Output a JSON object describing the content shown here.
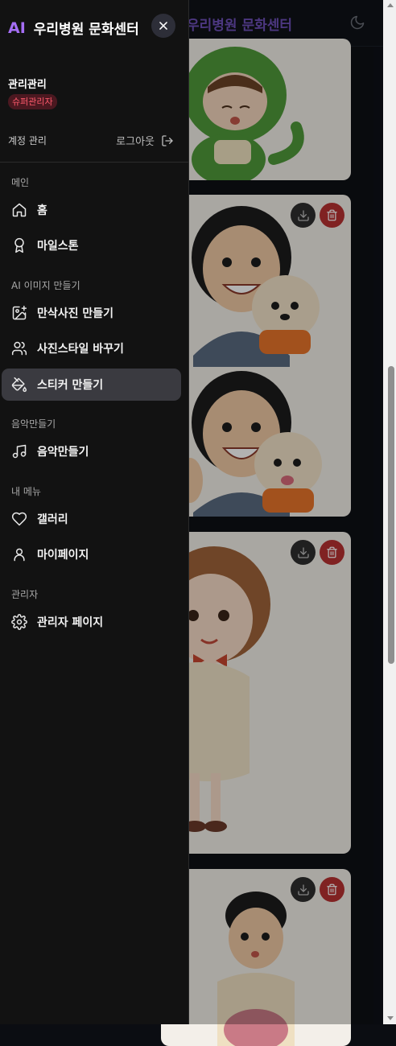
{
  "background": {
    "header_title": "우리병원 문화센터",
    "theme_toggle_icon": "moon-icon",
    "cards": [
      {
        "download_icon": "download-icon",
        "delete_icon": "trash-icon"
      },
      {
        "download_icon": "download-icon",
        "delete_icon": "trash-icon"
      },
      {
        "download_icon": "download-icon",
        "delete_icon": "trash-icon"
      },
      {
        "download_icon": "download-icon",
        "delete_icon": "trash-icon"
      }
    ]
  },
  "sidebar": {
    "brand_ai": "AI",
    "brand_name": "우리병원 문화센터",
    "close_icon": "close-icon",
    "user_name": "관리관리",
    "role_badge": "슈퍼관리자",
    "account_label": "계정 관리",
    "logout_label": "로그아웃",
    "sections": [
      {
        "label": "메인",
        "items": [
          {
            "label": "홈",
            "icon": "home-icon"
          },
          {
            "label": "마일스톤",
            "icon": "award-icon"
          }
        ]
      },
      {
        "label": "AI 이미지 만들기",
        "items": [
          {
            "label": "만삭사진 만들기",
            "icon": "image-plus-icon"
          },
          {
            "label": "사진스타일 바꾸기",
            "icon": "users-icon"
          },
          {
            "label": "스티커 만들기",
            "icon": "paint-bucket-icon",
            "active": true
          }
        ]
      },
      {
        "label": "음악만들기",
        "items": [
          {
            "label": "음악만들기",
            "icon": "music-icon"
          }
        ]
      },
      {
        "label": "내 메뉴",
        "items": [
          {
            "label": "갤러리",
            "icon": "heart-icon"
          },
          {
            "label": "마이페이지",
            "icon": "user-icon"
          }
        ]
      },
      {
        "label": "관리자",
        "items": [
          {
            "label": "관리자 페이지",
            "icon": "settings-icon"
          }
        ]
      }
    ]
  },
  "colors": {
    "accent": "#a56ef5",
    "sidebar_bg": "#121212",
    "active_item_bg": "#3a3a40",
    "badge_bg": "#4b1820",
    "badge_text": "#ff5a6c",
    "delete_button": "#b83232"
  }
}
